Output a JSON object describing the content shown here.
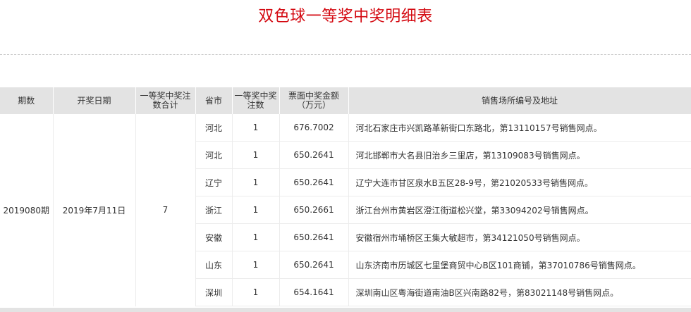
{
  "page": {
    "title": "双色球一等奖中奖明细表"
  },
  "table": {
    "headers": {
      "period": "期数",
      "draw_date": "开奖日期",
      "total_bets": "一等奖中奖注数合计",
      "province": "省市",
      "bets": "一等奖中奖注数",
      "amount": "票面中奖金额（万元）",
      "address": "销售场所编号及地址"
    },
    "group": {
      "period": "2019080期",
      "draw_date": "2019年7月11日",
      "total_bets": "7"
    },
    "rows": [
      {
        "province": "河北",
        "bets": "1",
        "amount": "676.7002",
        "address": "河北石家庄市兴凯路革新街口东路北，第13110157号销售网点。"
      },
      {
        "province": "河北",
        "bets": "1",
        "amount": "650.2641",
        "address": "河北邯郸市大名县旧治乡三里店，第13109083号销售网点。"
      },
      {
        "province": "辽宁",
        "bets": "1",
        "amount": "650.2641",
        "address": "辽宁大连市甘区泉水B五区28-9号，第21020533号销售网点。"
      },
      {
        "province": "浙江",
        "bets": "1",
        "amount": "650.2661",
        "address": "浙江台州市黄岩区澄江街道松兴堂，第33094202号销售网点。"
      },
      {
        "province": "安徽",
        "bets": "1",
        "amount": "650.2641",
        "address": "安徽宿州市埇桥区王集大敏超市，第34121050号销售网点。"
      },
      {
        "province": "山东",
        "bets": "1",
        "amount": "650.2641",
        "address": "山东济南市历城区七里堡商贸中心B区101商铺，第37010786号销售网点。"
      },
      {
        "province": "深圳",
        "bets": "1",
        "amount": "654.1641",
        "address": "深圳南山区粤海街道南油B区兴南路82号，第83021148号销售网点。"
      }
    ]
  },
  "colors": {
    "title": "#d40a12",
    "header_bg": "#e3e3e3",
    "divider": "#c8c8c8"
  }
}
